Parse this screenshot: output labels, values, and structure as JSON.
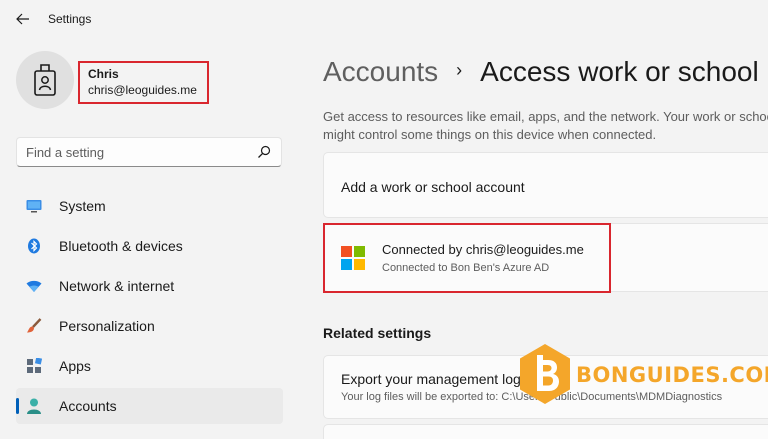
{
  "window": {
    "title": "Settings"
  },
  "user": {
    "name": "Chris",
    "email": "chris@leoguides.me"
  },
  "search": {
    "placeholder": "Find a setting"
  },
  "nav": {
    "items": [
      {
        "label": "System",
        "icon": "monitor-icon"
      },
      {
        "label": "Bluetooth & devices",
        "icon": "bluetooth-icon"
      },
      {
        "label": "Network & internet",
        "icon": "wifi-icon"
      },
      {
        "label": "Personalization",
        "icon": "brush-icon"
      },
      {
        "label": "Apps",
        "icon": "apps-icon"
      },
      {
        "label": "Accounts",
        "icon": "person-icon",
        "selected": true
      }
    ]
  },
  "breadcrumb": {
    "parent": "Accounts",
    "separator": "›",
    "current": "Access work or school"
  },
  "description": "Get access to resources like email, apps, and the network. Your work or school might control some things on this device when connected.",
  "add_account": {
    "label": "Add a work or school account"
  },
  "connected": {
    "title": "Connected by chris@leoguides.me",
    "subtitle": "Connected to Bon Ben's Azure AD"
  },
  "related": {
    "title": "Related settings",
    "export": {
      "title": "Export your management log files",
      "subtitle": "Your log files will be exported to: C:\\Users\\Public\\Documents\\MDMDiagnostics"
    }
  },
  "watermark": {
    "text": "BONGUIDES.COM"
  },
  "colors": {
    "accent": "#005fb8",
    "highlight": "#d9262e",
    "watermark": "#f4a62a"
  }
}
